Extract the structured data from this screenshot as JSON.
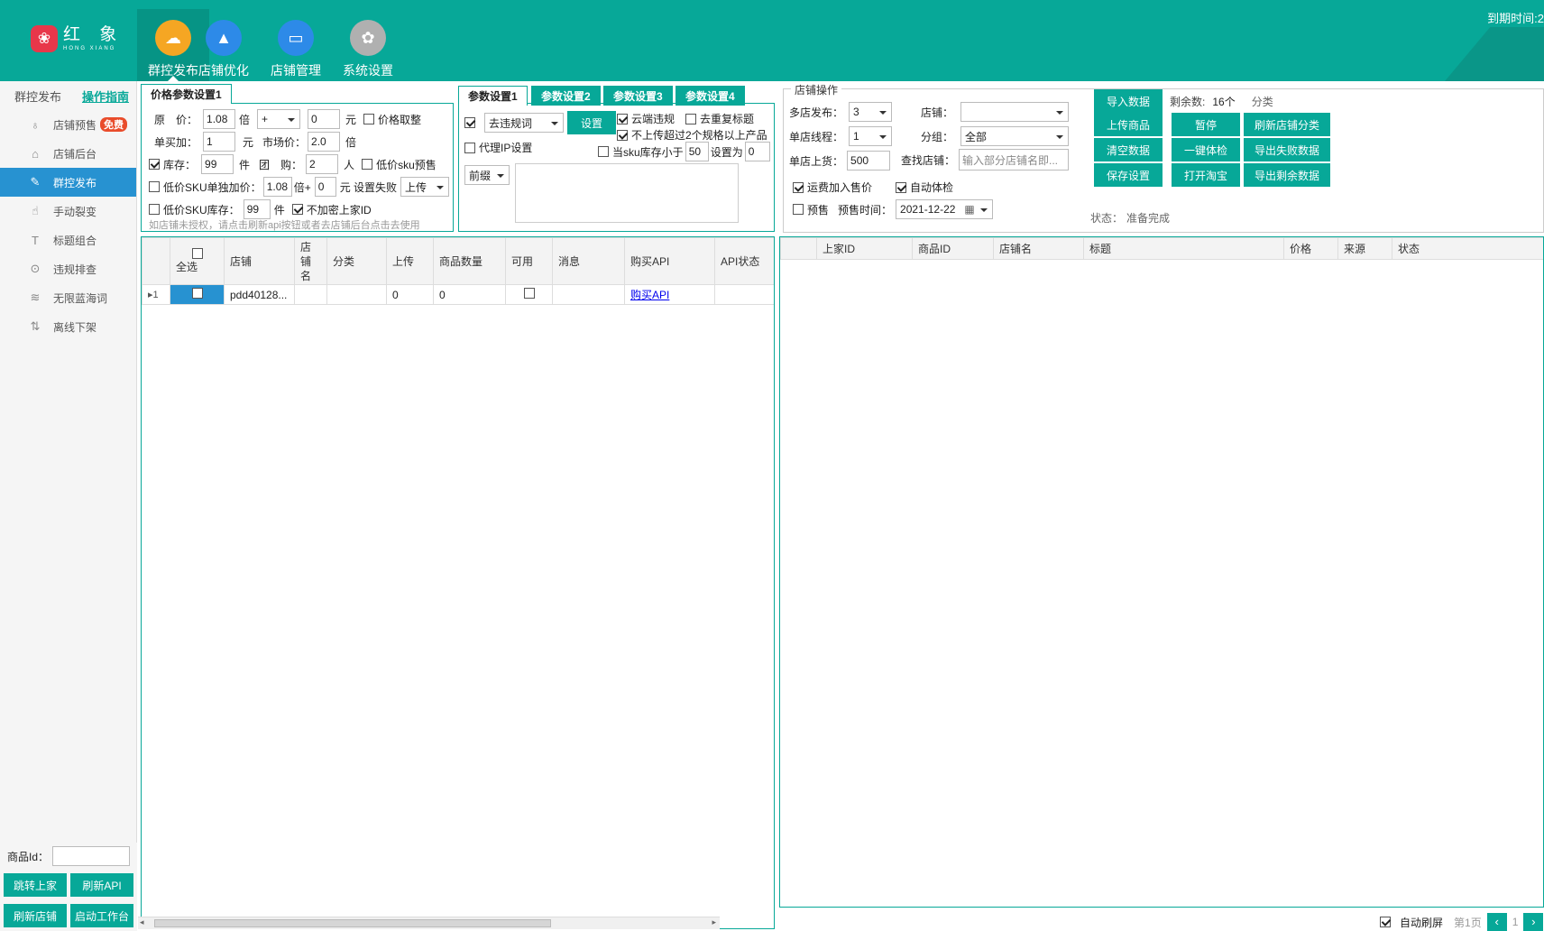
{
  "app": {
    "logo_cn": "红 象",
    "logo_en": "HONG XIANG",
    "expire_label": "到期时间:2"
  },
  "nav": [
    {
      "label": "群控发布",
      "icon": "cloud-upload-icon",
      "color": "#f5a623"
    },
    {
      "label": "店铺优化",
      "icon": "rocket-icon",
      "color": "#2d8ae8"
    },
    {
      "label": "店铺管理",
      "icon": "monitor-icon",
      "color": "#2d8ae8"
    },
    {
      "label": "系统设置",
      "icon": "gear-icon",
      "color": "#b0b0b0"
    }
  ],
  "sidebar": {
    "header": "群控发布",
    "guide": "操作指南",
    "items": [
      {
        "label": "店铺预售",
        "icon": "presale-icon",
        "badge": "免费"
      },
      {
        "label": "店铺后台",
        "icon": "store-icon"
      },
      {
        "label": "群控发布",
        "icon": "publish-icon"
      },
      {
        "label": "手动裂变",
        "icon": "hand-icon"
      },
      {
        "label": "标题组合",
        "icon": "title-icon"
      },
      {
        "label": "违规排查",
        "icon": "search-icon"
      },
      {
        "label": "无限蓝海词",
        "icon": "wave-icon"
      },
      {
        "label": "离线下架",
        "icon": "offline-icon"
      }
    ],
    "product_id_label": "商品Id：",
    "buttons": {
      "jump": "跳转上家",
      "refresh_api": "刷新API",
      "refresh_shop": "刷新店铺",
      "start_workbench": "启动工作台"
    }
  },
  "price_panel": {
    "tab": "价格参数设置1",
    "original_price_label": "原　价：",
    "original_price": "1.08",
    "times": "倍",
    "op": "+",
    "add_value": "0",
    "yuan": "元",
    "round_label": "价格取整",
    "single_buy_label": "单买加：",
    "single_buy": "1",
    "market_label": "市场价：",
    "market_value": "2.0",
    "stock_label": "库存：",
    "stock": "99",
    "piece": "件",
    "group_label": "团　购：",
    "group_value": "2",
    "person": "人",
    "low_sku_presale": "低价sku预售",
    "low_sku_price_label": "低价SKU单独加价：",
    "low_sku_times": "1.08",
    "times_plus": "倍+",
    "low_sku_add": "0",
    "fail_label": "元 设置失败",
    "fail_option": "上传",
    "low_sku_stock_label": "低价SKU库存：",
    "low_sku_stock": "99",
    "no_encrypt": "不加密上家ID",
    "note": "如店铺未授权，请点击刷新api按钮或者去店铺后台点击去使用"
  },
  "param_panel": {
    "tabs": [
      "参数设置1",
      "参数设置2",
      "参数设置3",
      "参数设置4"
    ],
    "remove_select": "去违规词",
    "set_btn": "设置",
    "cloud_check": "云端违规",
    "dedupe_title": "去重复标题",
    "skip_multi": "不上传超过2个规格以上产品",
    "proxy_ip": "代理IP设置",
    "sku_stock_label": "当sku库存小于",
    "sku_stock_min": "50",
    "set_to_label": "设置为",
    "set_to_value": "0",
    "prefix": "前缀"
  },
  "shop_ops": {
    "title": "店铺操作",
    "multi_publish_label": "多店发布：",
    "multi_publish": "3",
    "shop_label": "店铺：",
    "shop_value": "",
    "thread_label": "单店线程：",
    "thread": "1",
    "group_label": "分组：",
    "group": "全部",
    "single_upload_label": "单店上货：",
    "single_upload": "500",
    "find_shop_label": "查找店铺：",
    "find_shop_placeholder": "输入部分店铺名即...",
    "freight": "运费加入售价",
    "auto_check": "自动体检",
    "presale": "预售",
    "presale_time_label": "预售时间：",
    "presale_time": "2021-12-22",
    "remaining_label": "剩余数:",
    "remaining": "16个",
    "category_label": "分类",
    "status_label": "状态：",
    "status": "准备完成",
    "buttons": {
      "import": "导入数据",
      "upload": "上传商品",
      "pause": "暂停",
      "refresh_cat": "刷新店铺分类",
      "clear": "清空数据",
      "one_check": "一键体检",
      "export_fail": "导出失败数据",
      "save": "保存设置",
      "open_taobao": "打开淘宝",
      "export_rest": "导出剩余数据"
    }
  },
  "shop_table": {
    "headers": [
      "全选",
      "店铺",
      "店铺名",
      "分类",
      "上传",
      "商品数量",
      "可用",
      "消息",
      "购买API",
      "API状态"
    ],
    "rows": [
      {
        "index": "1",
        "shop": "pdd40128...",
        "shop_name": "",
        "category": "",
        "upload": "0",
        "count": "0",
        "msg": "",
        "buy_api": "购买API",
        "api_status": ""
      }
    ]
  },
  "goods_table": {
    "headers": [
      "上家ID",
      "商品ID",
      "店铺名",
      "标题",
      "价格",
      "来源",
      "状态"
    ]
  },
  "footer": {
    "auto_refresh": "自动刷屏",
    "page_label": "第1页",
    "page": "1"
  }
}
